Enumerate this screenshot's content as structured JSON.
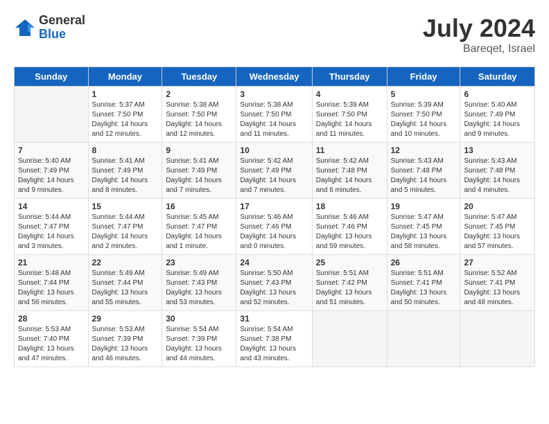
{
  "logo": {
    "general": "General",
    "blue": "Blue"
  },
  "title": {
    "month_year": "July 2024",
    "location": "Bareqet, Israel"
  },
  "calendar": {
    "headers": [
      "Sunday",
      "Monday",
      "Tuesday",
      "Wednesday",
      "Thursday",
      "Friday",
      "Saturday"
    ],
    "weeks": [
      [
        {
          "day": "",
          "info": ""
        },
        {
          "day": "1",
          "info": "Sunrise: 5:37 AM\nSunset: 7:50 PM\nDaylight: 14 hours\nand 12 minutes."
        },
        {
          "day": "2",
          "info": "Sunrise: 5:38 AM\nSunset: 7:50 PM\nDaylight: 14 hours\nand 12 minutes."
        },
        {
          "day": "3",
          "info": "Sunrise: 5:38 AM\nSunset: 7:50 PM\nDaylight: 14 hours\nand 11 minutes."
        },
        {
          "day": "4",
          "info": "Sunrise: 5:39 AM\nSunset: 7:50 PM\nDaylight: 14 hours\nand 11 minutes."
        },
        {
          "day": "5",
          "info": "Sunrise: 5:39 AM\nSunset: 7:50 PM\nDaylight: 14 hours\nand 10 minutes."
        },
        {
          "day": "6",
          "info": "Sunrise: 5:40 AM\nSunset: 7:49 PM\nDaylight: 14 hours\nand 9 minutes."
        }
      ],
      [
        {
          "day": "7",
          "info": "Sunrise: 5:40 AM\nSunset: 7:49 PM\nDaylight: 14 hours\nand 9 minutes."
        },
        {
          "day": "8",
          "info": "Sunrise: 5:41 AM\nSunset: 7:49 PM\nDaylight: 14 hours\nand 8 minutes."
        },
        {
          "day": "9",
          "info": "Sunrise: 5:41 AM\nSunset: 7:49 PM\nDaylight: 14 hours\nand 7 minutes."
        },
        {
          "day": "10",
          "info": "Sunrise: 5:42 AM\nSunset: 7:49 PM\nDaylight: 14 hours\nand 7 minutes."
        },
        {
          "day": "11",
          "info": "Sunrise: 5:42 AM\nSunset: 7:48 PM\nDaylight: 14 hours\nand 6 minutes."
        },
        {
          "day": "12",
          "info": "Sunrise: 5:43 AM\nSunset: 7:48 PM\nDaylight: 14 hours\nand 5 minutes."
        },
        {
          "day": "13",
          "info": "Sunrise: 5:43 AM\nSunset: 7:48 PM\nDaylight: 14 hours\nand 4 minutes."
        }
      ],
      [
        {
          "day": "14",
          "info": "Sunrise: 5:44 AM\nSunset: 7:47 PM\nDaylight: 14 hours\nand 3 minutes."
        },
        {
          "day": "15",
          "info": "Sunrise: 5:44 AM\nSunset: 7:47 PM\nDaylight: 14 hours\nand 2 minutes."
        },
        {
          "day": "16",
          "info": "Sunrise: 5:45 AM\nSunset: 7:47 PM\nDaylight: 14 hours\nand 1 minute."
        },
        {
          "day": "17",
          "info": "Sunrise: 5:46 AM\nSunset: 7:46 PM\nDaylight: 14 hours\nand 0 minutes."
        },
        {
          "day": "18",
          "info": "Sunrise: 5:46 AM\nSunset: 7:46 PM\nDaylight: 13 hours\nand 59 minutes."
        },
        {
          "day": "19",
          "info": "Sunrise: 5:47 AM\nSunset: 7:45 PM\nDaylight: 13 hours\nand 58 minutes."
        },
        {
          "day": "20",
          "info": "Sunrise: 5:47 AM\nSunset: 7:45 PM\nDaylight: 13 hours\nand 57 minutes."
        }
      ],
      [
        {
          "day": "21",
          "info": "Sunrise: 5:48 AM\nSunset: 7:44 PM\nDaylight: 13 hours\nand 56 minutes."
        },
        {
          "day": "22",
          "info": "Sunrise: 5:49 AM\nSunset: 7:44 PM\nDaylight: 13 hours\nand 55 minutes."
        },
        {
          "day": "23",
          "info": "Sunrise: 5:49 AM\nSunset: 7:43 PM\nDaylight: 13 hours\nand 53 minutes."
        },
        {
          "day": "24",
          "info": "Sunrise: 5:50 AM\nSunset: 7:43 PM\nDaylight: 13 hours\nand 52 minutes."
        },
        {
          "day": "25",
          "info": "Sunrise: 5:51 AM\nSunset: 7:42 PM\nDaylight: 13 hours\nand 51 minutes."
        },
        {
          "day": "26",
          "info": "Sunrise: 5:51 AM\nSunset: 7:41 PM\nDaylight: 13 hours\nand 50 minutes."
        },
        {
          "day": "27",
          "info": "Sunrise: 5:52 AM\nSunset: 7:41 PM\nDaylight: 13 hours\nand 48 minutes."
        }
      ],
      [
        {
          "day": "28",
          "info": "Sunrise: 5:53 AM\nSunset: 7:40 PM\nDaylight: 13 hours\nand 47 minutes."
        },
        {
          "day": "29",
          "info": "Sunrise: 5:53 AM\nSunset: 7:39 PM\nDaylight: 13 hours\nand 46 minutes."
        },
        {
          "day": "30",
          "info": "Sunrise: 5:54 AM\nSunset: 7:39 PM\nDaylight: 13 hours\nand 44 minutes."
        },
        {
          "day": "31",
          "info": "Sunrise: 5:54 AM\nSunset: 7:38 PM\nDaylight: 13 hours\nand 43 minutes."
        },
        {
          "day": "",
          "info": ""
        },
        {
          "day": "",
          "info": ""
        },
        {
          "day": "",
          "info": ""
        }
      ]
    ]
  }
}
